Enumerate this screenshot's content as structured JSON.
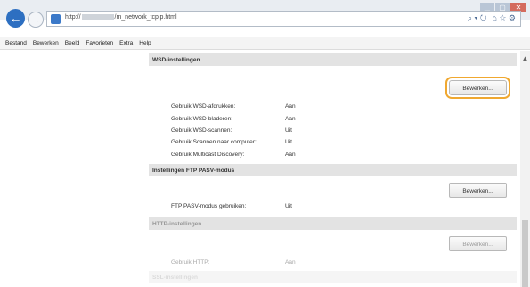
{
  "browser": {
    "url_prefix": "http://",
    "url_suffix": "/m_network_tcpip.html",
    "address_icons": [
      "⌕ ▾ ↻",
      "⌂ ☆ ⚙"
    ]
  },
  "menu": [
    "Bestand",
    "Bewerken",
    "Beeld",
    "Favorieten",
    "Extra",
    "Help"
  ],
  "sections": {
    "wsd": {
      "title": "WSD-instellingen",
      "edit_label": "Bewerken...",
      "rows": [
        {
          "label": "Gebruik WSD-afdrukken:",
          "value": "Aan"
        },
        {
          "label": "Gebruik WSD-bladeren:",
          "value": "Aan"
        },
        {
          "label": "Gebruik WSD-scannen:",
          "value": "Uit"
        },
        {
          "label": "Gebruik Scannen naar computer:",
          "value": "Uit"
        },
        {
          "label": "Gebruik Multicast Discovery:",
          "value": "Aan"
        }
      ]
    },
    "ftp": {
      "title": "Instellingen FTP PASV-modus",
      "edit_label": "Bewerken...",
      "rows": [
        {
          "label": "FTP PASV-modus gebruiken:",
          "value": "Uit"
        }
      ]
    },
    "http": {
      "title": "HTTP-instellingen",
      "edit_label": "Bewerken...",
      "rows": [
        {
          "label": "Gebruik HTTP:",
          "value": "Aan"
        }
      ]
    },
    "ssl": {
      "title": "SSL-instellingen"
    }
  },
  "colors": {
    "highlight": "#f0a830",
    "back_button": "#2d6fc1",
    "section_header": "#e3e3e3"
  }
}
